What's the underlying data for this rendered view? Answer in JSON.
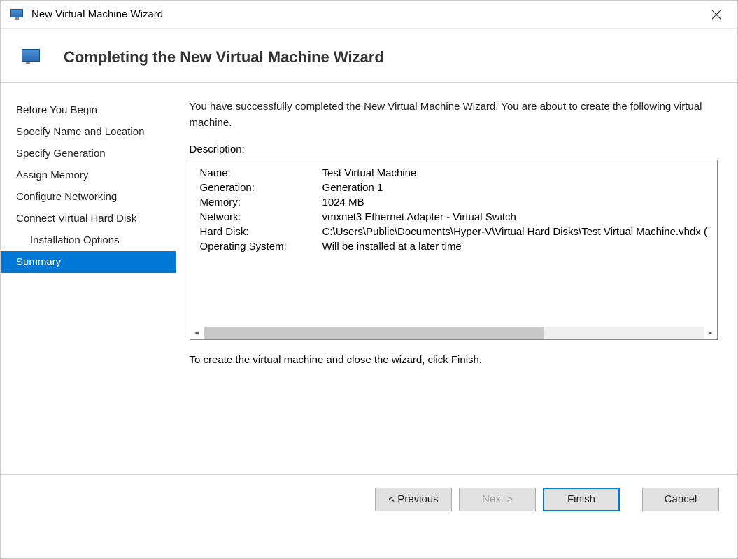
{
  "window": {
    "title": "New Virtual Machine Wizard"
  },
  "header": {
    "title": "Completing the New Virtual Machine Wizard"
  },
  "sidebar": {
    "items": [
      {
        "label": "Before You Begin",
        "indent": false,
        "active": false
      },
      {
        "label": "Specify Name and Location",
        "indent": false,
        "active": false
      },
      {
        "label": "Specify Generation",
        "indent": false,
        "active": false
      },
      {
        "label": "Assign Memory",
        "indent": false,
        "active": false
      },
      {
        "label": "Configure Networking",
        "indent": false,
        "active": false
      },
      {
        "label": "Connect Virtual Hard Disk",
        "indent": false,
        "active": false
      },
      {
        "label": "Installation Options",
        "indent": true,
        "active": false
      },
      {
        "label": "Summary",
        "indent": false,
        "active": true
      }
    ]
  },
  "main": {
    "intro": "You have successfully completed the New Virtual Machine Wizard. You are about to create the following virtual machine.",
    "description_label": "Description:",
    "rows": [
      {
        "key": "Name:",
        "value": "Test Virtual Machine"
      },
      {
        "key": "Generation:",
        "value": "Generation 1"
      },
      {
        "key": "Memory:",
        "value": "1024 MB"
      },
      {
        "key": "Network:",
        "value": "vmxnet3 Ethernet Adapter - Virtual Switch"
      },
      {
        "key": "Hard Disk:",
        "value": "C:\\Users\\Public\\Documents\\Hyper-V\\Virtual Hard Disks\\Test Virtual Machine.vhdx ("
      },
      {
        "key": "Operating System:",
        "value": "Will be installed at a later time"
      }
    ],
    "finish_hint": "To create the virtual machine and close the wizard, click Finish."
  },
  "footer": {
    "previous": "< Previous",
    "next": "Next >",
    "finish": "Finish",
    "cancel": "Cancel"
  }
}
